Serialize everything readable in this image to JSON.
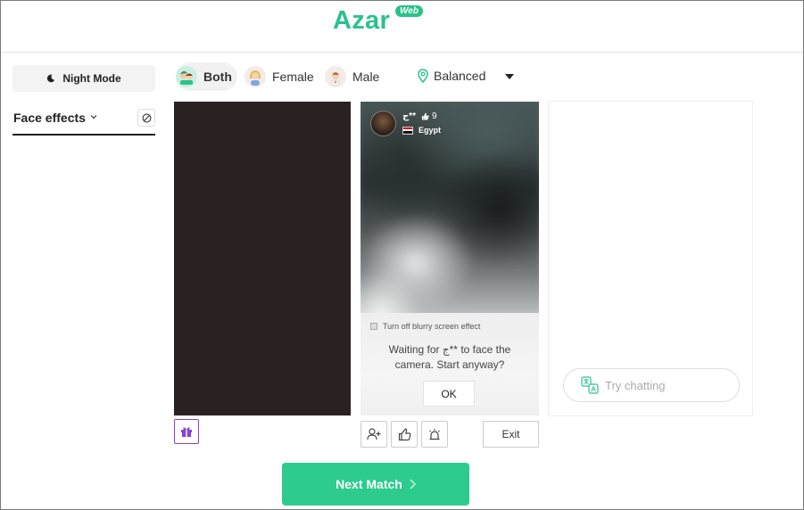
{
  "header": {
    "logo": "Azar",
    "badge": "Web"
  },
  "sidebar": {
    "night_mode_label": "Night Mode",
    "face_effects_label": "Face effects"
  },
  "filters": {
    "gender": [
      {
        "label": "Both",
        "active": true
      },
      {
        "label": "Female",
        "active": false
      },
      {
        "label": "Male",
        "active": false
      }
    ],
    "location_label": "Balanced"
  },
  "partner": {
    "name": "ج**",
    "likes": "9",
    "country": "Egypt",
    "blurry_option_label": "Turn off blurry screen effect",
    "waiting_message": "Waiting for ج** to face the camera. Start anyway?",
    "ok_label": "OK"
  },
  "actions": {
    "exit_label": "Exit"
  },
  "chat": {
    "placeholder": "Try chatting"
  },
  "next_match_label": "Next Match",
  "colors": {
    "accent": "#2dcb8e",
    "gift": "#8a3fd6",
    "my_video_bg": "#2a2220"
  },
  "icons": [
    "moon-icon",
    "chevron-down-icon",
    "no-effect-icon",
    "location-pin-icon",
    "gift-icon",
    "add-friend-icon",
    "thumbs-up-icon",
    "report-siren-icon",
    "translate-icon",
    "chevron-right-icon"
  ]
}
